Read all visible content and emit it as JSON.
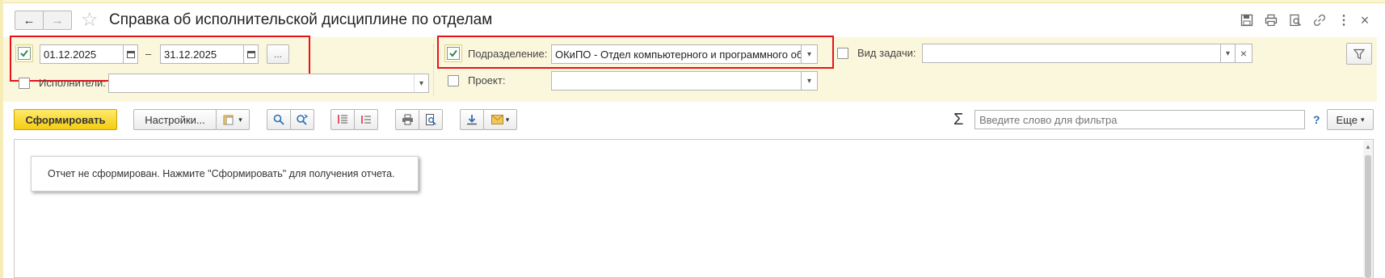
{
  "window": {
    "title": "Справка об исполнительской дисциплине по отделам",
    "back_icon": "←",
    "forward_icon": "→",
    "favorite_icon": "☆",
    "tools": [
      "save-icon",
      "print-icon",
      "preview-icon",
      "link-icon",
      "more-icon",
      "close-icon"
    ],
    "close_glyph": "×",
    "more_glyph": "⋮"
  },
  "filters": {
    "period": {
      "checked": true,
      "date_from": "01.12.2025",
      "separator": "–",
      "date_to": "31.12.2025",
      "choose_label": "..."
    },
    "executors": {
      "label": "Исполнители:",
      "checked": false,
      "value": ""
    },
    "department": {
      "label": "Подразделение:",
      "checked": true,
      "value": "ОКиПО - Отдел компьютерного и программного об"
    },
    "project": {
      "label": "Проект:",
      "checked": false,
      "value": ""
    },
    "task_type": {
      "label": "Вид задачи:",
      "checked": false,
      "value": ""
    },
    "clear_glyph": "×"
  },
  "toolbar": {
    "generate_label": "Сформировать",
    "settings_label": "Настройки...",
    "sigma_glyph": "Σ",
    "search_placeholder": "Введите слово для фильтра",
    "help_label": "?",
    "more_label": "Еще"
  },
  "report": {
    "message": "Отчет не сформирован. Нажмите \"Сформировать\" для получения отчета."
  },
  "colors": {
    "accent_yellow": "#f4cd10",
    "highlight_red": "#e8121b",
    "filter_bg": "#fbf7dd"
  }
}
